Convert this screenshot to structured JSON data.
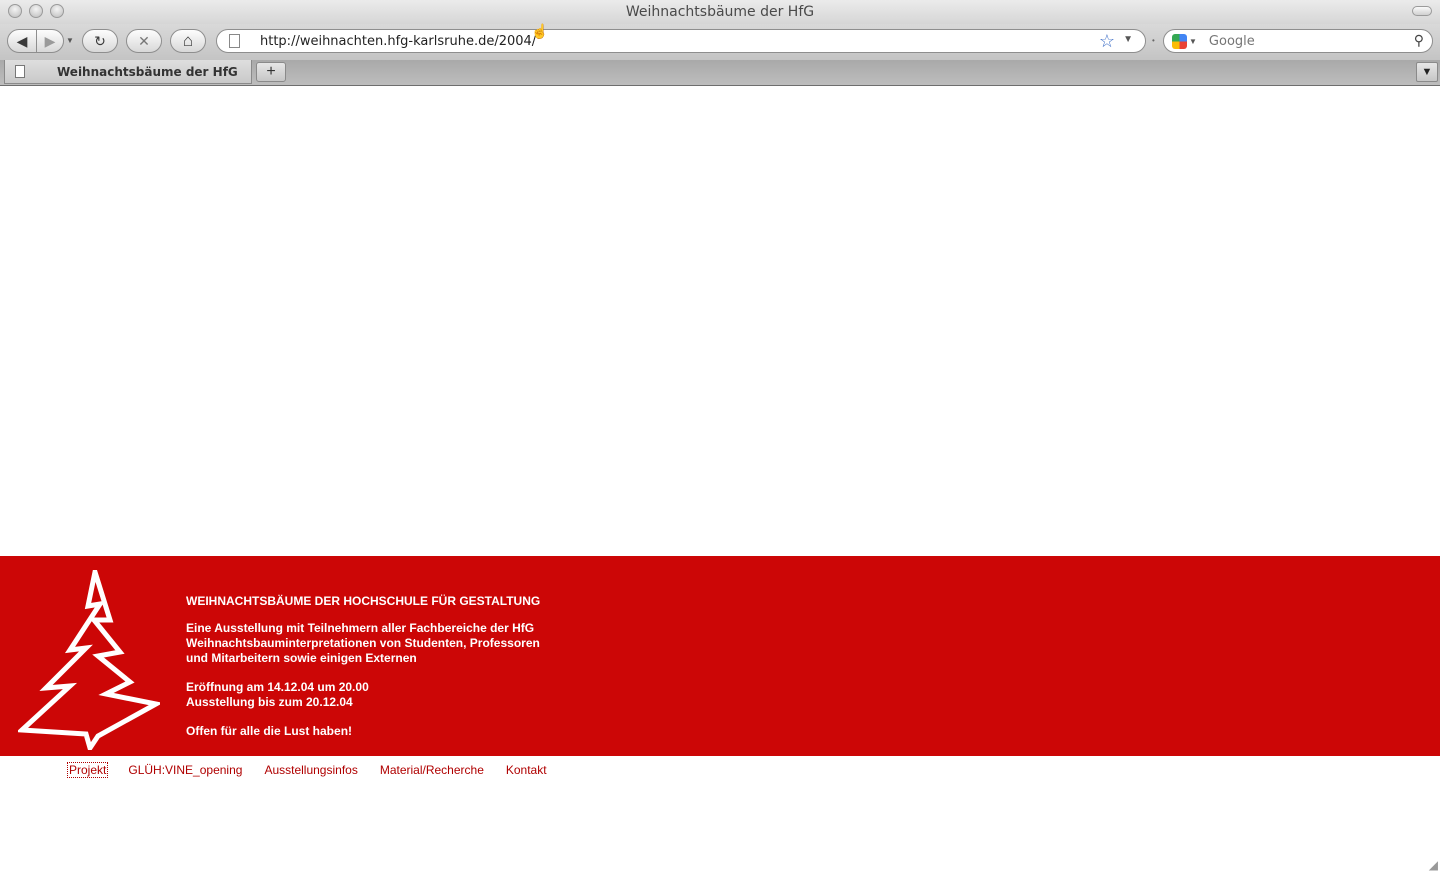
{
  "window": {
    "title": "Weihnachtsbäume der HfG"
  },
  "toolbar": {
    "back": "◀",
    "forward": "▶",
    "reload": "↻",
    "stop": "✕",
    "home": "⌂",
    "url": "http://weihnachten.hfg-karlsruhe.de/2004/",
    "search_placeholder": "Google"
  },
  "tabs": [
    {
      "label": "Weihnachtsbäume der HfG"
    }
  ],
  "banner": {
    "heading": "WEIHNACHTSBÄUME DER HOCHSCHULE FÜR GESTALTUNG",
    "intro": [
      "Eine Ausstellung mit Teilnehmern aller Fachbereiche der HfG",
      "Weihnachtsbauminterpretationen von Studenten, Professoren",
      "und Mitarbeitern sowie einigen Externen"
    ],
    "dates": [
      "Eröffnung am 14.12.04 um 20.00",
      "Ausstellung bis zum 20.12.04"
    ],
    "closing": "Offen für alle die Lust haben!"
  },
  "nav": [
    {
      "label": "Projekt",
      "active": true
    },
    {
      "label": "GLÜH:VINE_opening",
      "active": false
    },
    {
      "label": "Ausstellungsinfos",
      "active": false
    },
    {
      "label": "Material/Recherche",
      "active": false
    },
    {
      "label": "Kontakt",
      "active": false
    }
  ],
  "colors": {
    "banner": "#cc0606",
    "link": "#b00000"
  },
  "icons": {
    "back": "back-arrow-icon",
    "forward": "forward-arrow-icon",
    "reload": "reload-icon",
    "stop": "stop-icon",
    "home": "home-icon",
    "bookmark": "star-icon",
    "search": "magnifier-icon",
    "tree": "christmas-tree-icon"
  }
}
